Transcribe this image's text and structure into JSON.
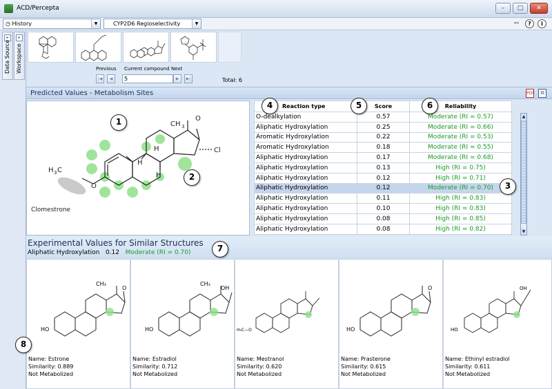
{
  "window": {
    "title": "ACD/Percepta"
  },
  "toolbar": {
    "history_label": "History",
    "module_label": "CYP2D6 Regioselectivity"
  },
  "side_tabs": [
    "Data Source",
    "Workspace"
  ],
  "navigation": {
    "previous_label": "Previous",
    "current_label": "Current compound",
    "next_label": "Next",
    "current_value": "5",
    "total_label": "Total: 6"
  },
  "predicted": {
    "title": "Predicted Values - Metabolism Sites",
    "compound_name": "Clomestrone",
    "headers": {
      "reaction": "Reaction type",
      "score": "Score",
      "reliability": "Reliability"
    },
    "rows": [
      {
        "reaction": "O-dealkylation",
        "score": "0.57",
        "reliability": "Moderate (RI = 0.57)"
      },
      {
        "reaction": "Aliphatic Hydroxylation",
        "score": "0.25",
        "reliability": "Moderate (RI = 0.66)"
      },
      {
        "reaction": "Aromatic Hydroxylation",
        "score": "0.22",
        "reliability": "Moderate (RI = 0.53)"
      },
      {
        "reaction": "Aromatic Hydroxylation",
        "score": "0.18",
        "reliability": "Moderate (RI = 0.55)"
      },
      {
        "reaction": "Aliphatic Hydroxylation",
        "score": "0.17",
        "reliability": "Moderate (RI = 0.68)"
      },
      {
        "reaction": "Aliphatic Hydroxylation",
        "score": "0.13",
        "reliability": "High (RI = 0.75)"
      },
      {
        "reaction": "Aliphatic Hydroxylation",
        "score": "0.12",
        "reliability": "High (RI = 0.71)"
      },
      {
        "reaction": "Aliphatic Hydroxylation",
        "score": "0.12",
        "reliability": "Moderate (RI = 0.70)"
      },
      {
        "reaction": "Aliphatic Hydroxylation",
        "score": "0.11",
        "reliability": "High (RI = 0.83)"
      },
      {
        "reaction": "Aliphatic Hydroxylation",
        "score": "0.10",
        "reliability": "High (RI = 0.83)"
      },
      {
        "reaction": "Aliphatic Hydroxylation",
        "score": "0.08",
        "reliability": "High (RI = 0.85)"
      },
      {
        "reaction": "Aliphatic Hydroxylation",
        "score": "0.08",
        "reliability": "High (RI = 0.82)"
      }
    ],
    "selected_row": 7,
    "structure_labels": {
      "ch3_top": "CH",
      "sub3": "3",
      "ketone": "O",
      "chloro": "Cl",
      "h1": "H",
      "h2": "H",
      "h3": "H",
      "methoxy": "H",
      "sub3b": "3",
      "oxy": "C",
      "o": "O"
    }
  },
  "experimental": {
    "title": "Experimental Values for Similar Structures",
    "reaction": "Aliphatic Hydroxylation",
    "score": "0.12",
    "reliability": "Moderate (RI = 0.70)",
    "compounds": [
      {
        "name": "Name: Estrone",
        "similarity": "Similarity: 0.889",
        "status": "Not Metabolized"
      },
      {
        "name": "Name: Estradiol",
        "similarity": "Similarity: 0.712",
        "status": "Not Metabolized"
      },
      {
        "name": "Name: Mestranol",
        "similarity": "Similarity: 0.620",
        "status": "Not Metabolized"
      },
      {
        "name": "Name: Prasterone",
        "similarity": "Similarity: 0.615",
        "status": "Not Metabolized"
      },
      {
        "name": "Name: Ethinyl estradiol",
        "similarity": "Similarity: 0.611",
        "status": "Not Metabolized"
      }
    ]
  },
  "callouts": [
    "1",
    "2",
    "3",
    "4",
    "5",
    "6",
    "7",
    "8"
  ],
  "colors": {
    "reliability_green": "#1a9a22",
    "site_green": "#8fe08a",
    "selected_row": "#c5d5ec",
    "header_blue": "#c3d5ed"
  }
}
